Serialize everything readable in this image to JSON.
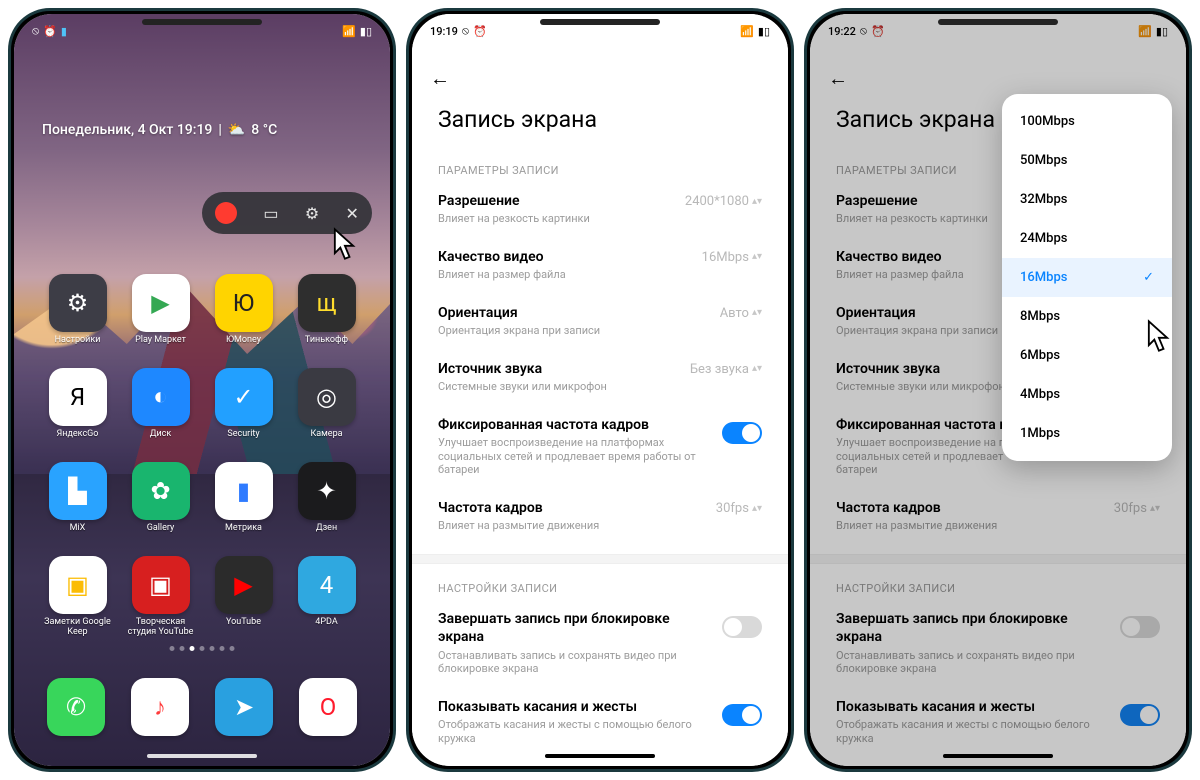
{
  "phone1": {
    "status_time": "",
    "date_line": "Понедельник, 4 Окт  19:19",
    "temperature": "8 °C",
    "apps": [
      {
        "label": "Настройки",
        "bg": "#3d3d46",
        "glyph": "⚙"
      },
      {
        "label": "Play Маркет",
        "bg": "#ffffff",
        "glyph": "▶",
        "fg": "#34a853"
      },
      {
        "label": "ЮMoney",
        "bg": "#ffd400",
        "glyph": "Ю",
        "fg": "#222"
      },
      {
        "label": "Тинькофф",
        "bg": "#2e2e2e",
        "glyph": "щ",
        "fg": "#ffdd2d"
      },
      {
        "label": "ЯндексGo",
        "bg": "#ffffff",
        "glyph": "Я",
        "fg": "#000"
      },
      {
        "label": "Диск",
        "bg": "#1e88ff",
        "glyph": "◐"
      },
      {
        "label": "Security",
        "bg": "#22a0ff",
        "glyph": "✓"
      },
      {
        "label": "Камера",
        "bg": "#3a3a42",
        "glyph": "◎"
      },
      {
        "label": "MiX",
        "bg": "#29a3ff",
        "glyph": "▙"
      },
      {
        "label": "Gallery",
        "bg": "#19b56e",
        "glyph": "✿"
      },
      {
        "label": "Метрика",
        "bg": "#ffffff",
        "glyph": "▮",
        "fg": "#2f7bff"
      },
      {
        "label": "Дзен",
        "bg": "#1b1b1d",
        "glyph": "✦"
      },
      {
        "label": "Заметки Google Keep",
        "bg": "#ffffff",
        "glyph": "▣",
        "fg": "#fbbc04"
      },
      {
        "label": "Творческая студия YouTube",
        "bg": "#d71f1f",
        "glyph": "▣"
      },
      {
        "label": "YouTube",
        "bg": "#2b2b2b",
        "glyph": "▶",
        "fg": "#ff0000"
      },
      {
        "label": "4PDA",
        "bg": "#2fa8e0",
        "glyph": "4"
      }
    ],
    "dock": [
      {
        "bg": "#38d65b",
        "glyph": "✆"
      },
      {
        "bg": "#ffffff",
        "glyph": "♪",
        "fg": "#ff3b3b"
      },
      {
        "bg": "#29a0e0",
        "glyph": "➤"
      },
      {
        "bg": "#ffffff",
        "glyph": "O",
        "fg": "#ff1b2d"
      }
    ]
  },
  "phone2": {
    "status_time": "19:19",
    "page_title": "Запись экрана",
    "section_params": "ПАРАМЕТРЫ ЗАПИСИ",
    "section_rec": "НАСТРОЙКИ ЗАПИСИ",
    "rows": {
      "resolution": {
        "title": "Разрешение",
        "sub": "Влияет на резкость картинки",
        "value": "2400*1080"
      },
      "quality": {
        "title": "Качество видео",
        "sub": "Влияет на размер файла",
        "value": "16Mbps"
      },
      "orientation": {
        "title": "Ориентация",
        "sub": "Ориентация экрана при записи",
        "value": "Авто"
      },
      "audio": {
        "title": "Источник звука",
        "sub": "Системные звуки или микрофон",
        "value": "Без звука"
      },
      "fps_fixed": {
        "title": "Фиксированная частота кадров",
        "sub": "Улучшает воспроизведение на платформах социальных сетей и продлевает время работы от батареи"
      },
      "fps": {
        "title": "Частота кадров",
        "sub": "Влияет на размытие движения",
        "value": "30fps"
      },
      "lock": {
        "title": "Завершать запись при блокировке экрана",
        "sub": "Останавливать запись и сохранять видео при блокировке экрана"
      },
      "touch": {
        "title": "Показывать касания и жесты",
        "sub": "Отображать касания и жесты с помощью белого кружка"
      }
    }
  },
  "phone3": {
    "status_time": "19:22",
    "popup_options": [
      "100Mbps",
      "50Mbps",
      "32Mbps",
      "24Mbps",
      "16Mbps",
      "8Mbps",
      "6Mbps",
      "4Mbps",
      "1Mbps"
    ],
    "popup_selected": "16Mbps",
    "fps_fixed_title": "Фиксированная частота к",
    "fps_fixed_sub": "Улучшает воспроизведение на пл\nсоциальных сетей и продлевает\nбатареи"
  }
}
